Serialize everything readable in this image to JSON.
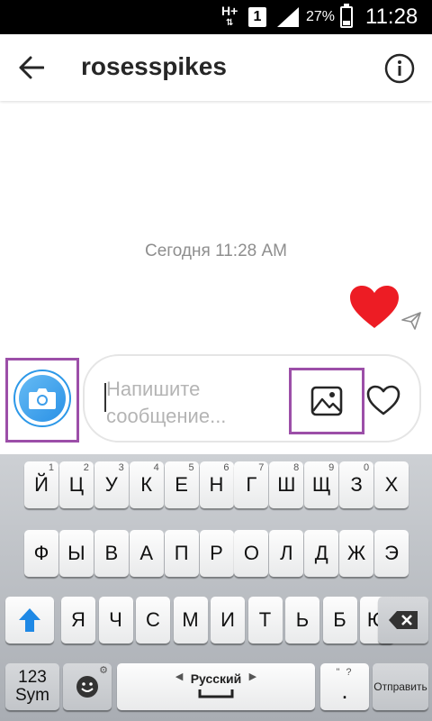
{
  "status_bar": {
    "network": "H+",
    "sim": "1",
    "battery_percent": "27%",
    "battery_level": 0.27,
    "time": "11:28"
  },
  "header": {
    "back_icon": "arrow-left-icon",
    "title": "rosesspikes",
    "info_icon": "info-circle-icon"
  },
  "conversation": {
    "timestamp": "Сегодня 11:28 AM",
    "messages": [
      {
        "type": "heart",
        "direction": "sent",
        "color": "#ed1c24",
        "status_icon": "sent-paper-plane-icon"
      }
    ]
  },
  "composer": {
    "camera_icon": "camera-icon",
    "placeholder": "Напишите сообщение...",
    "gallery_icon": "gallery-image-icon",
    "like_icon": "heart-outline-icon",
    "accent_color": "#2c98e8",
    "highlight_color": "#9c4fa8"
  },
  "keyboard": {
    "row1": [
      {
        "label": "Й",
        "hint": "1"
      },
      {
        "label": "Ц",
        "hint": "2"
      },
      {
        "label": "У",
        "hint": "3"
      },
      {
        "label": "К",
        "hint": "4"
      },
      {
        "label": "Е",
        "hint": "5"
      },
      {
        "label": "Н",
        "hint": "6"
      },
      {
        "label": "Г",
        "hint": "7"
      },
      {
        "label": "Ш",
        "hint": "8"
      },
      {
        "label": "Щ",
        "hint": "9"
      },
      {
        "label": "З",
        "hint": "0"
      },
      {
        "label": "Х",
        "hint": ""
      }
    ],
    "row2": [
      "Ф",
      "Ы",
      "В",
      "А",
      "П",
      "Р",
      "О",
      "Л",
      "Д",
      "Ж",
      "Э"
    ],
    "row3": [
      "Я",
      "Ч",
      "С",
      "М",
      "И",
      "Т",
      "Ь",
      "Б",
      "Ю"
    ],
    "shift_icon": "shift-arrow-icon",
    "backspace_icon": "backspace-icon",
    "sym_label_top": "123",
    "sym_label_bottom": "Sym",
    "emoji_icon": "emoji-smiley-icon",
    "space_label": "Русский",
    "period_label": ".",
    "send_label": "Отправить"
  }
}
